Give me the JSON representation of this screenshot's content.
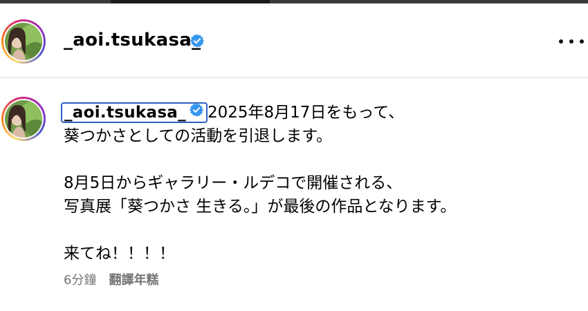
{
  "header": {
    "username": "_aoi.tsukasa_",
    "verified": true,
    "more_icon": "more-horizontal-icon"
  },
  "post": {
    "username": "_aoi.tsukasa_",
    "verified": true,
    "text_first": "2025年8月17日をもって、",
    "text_rest": "葵つかさとしての活動を引退します。\n\n8月5日からギャラリー・ルデコで開催される、\n写真展「葵つかさ 生きる。」が最後の作品となります。\n\n来てね！！！！",
    "timestamp": "6分鐘",
    "translate_label": "翻譯年糕"
  },
  "colors": {
    "verified_badge": "#3897f0",
    "highlight_box": "#2d5fc4",
    "meta_text": "#737373"
  }
}
